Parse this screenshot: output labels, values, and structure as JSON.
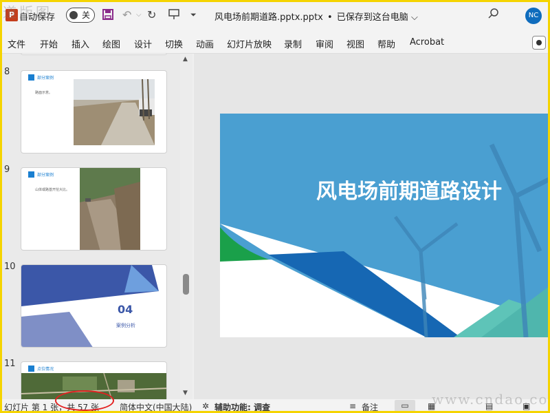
{
  "titlebar": {
    "app_icon": "P",
    "autosave_label": "自动保存",
    "autosave_state": "关",
    "save_icon": "save-icon",
    "undo_icon": "undo-icon",
    "redo_icon": "redo-icon",
    "present_icon": "present-icon",
    "customize_icon": "customize-icon",
    "document_title": "风电场前期道路.pptx.pptx",
    "saved_status": "已保存到这台电脑",
    "user_initials": "NC"
  },
  "watermark_top": "道版图",
  "watermark_bottom": "www.cndao.com",
  "menu": {
    "items": [
      "文件",
      "开始",
      "插入",
      "绘图",
      "设计",
      "切换",
      "动画",
      "幻灯片放映",
      "录制",
      "审阅",
      "视图",
      "帮助",
      "Acrobat"
    ]
  },
  "thumbnails": [
    {
      "number": "8",
      "section": "部分案例",
      "text": "路面示意。"
    },
    {
      "number": "9",
      "section": "部分案例",
      "text": "山体或路基开挖大比。"
    },
    {
      "number": "10",
      "big_number": "04",
      "subtitle": "案例分析"
    },
    {
      "number": "11",
      "section": "点位情况"
    }
  ],
  "main_slide": {
    "title": "风电场前期道路设计"
  },
  "statusbar": {
    "slide_info": "幻灯片 第 1 张，共 57 张",
    "language": "简体中文(中国大陆)",
    "accessibility": "辅助功能: 调查",
    "notes_label": "备注"
  },
  "colors": {
    "slide_blue": "#4a9fd1",
    "slide_dark_blue": "#1667b3",
    "slide_green": "#1aa04a",
    "title_red": "#c43e1c",
    "accent_blue": "#0f6cbd",
    "highlight_red": "#e32020"
  }
}
